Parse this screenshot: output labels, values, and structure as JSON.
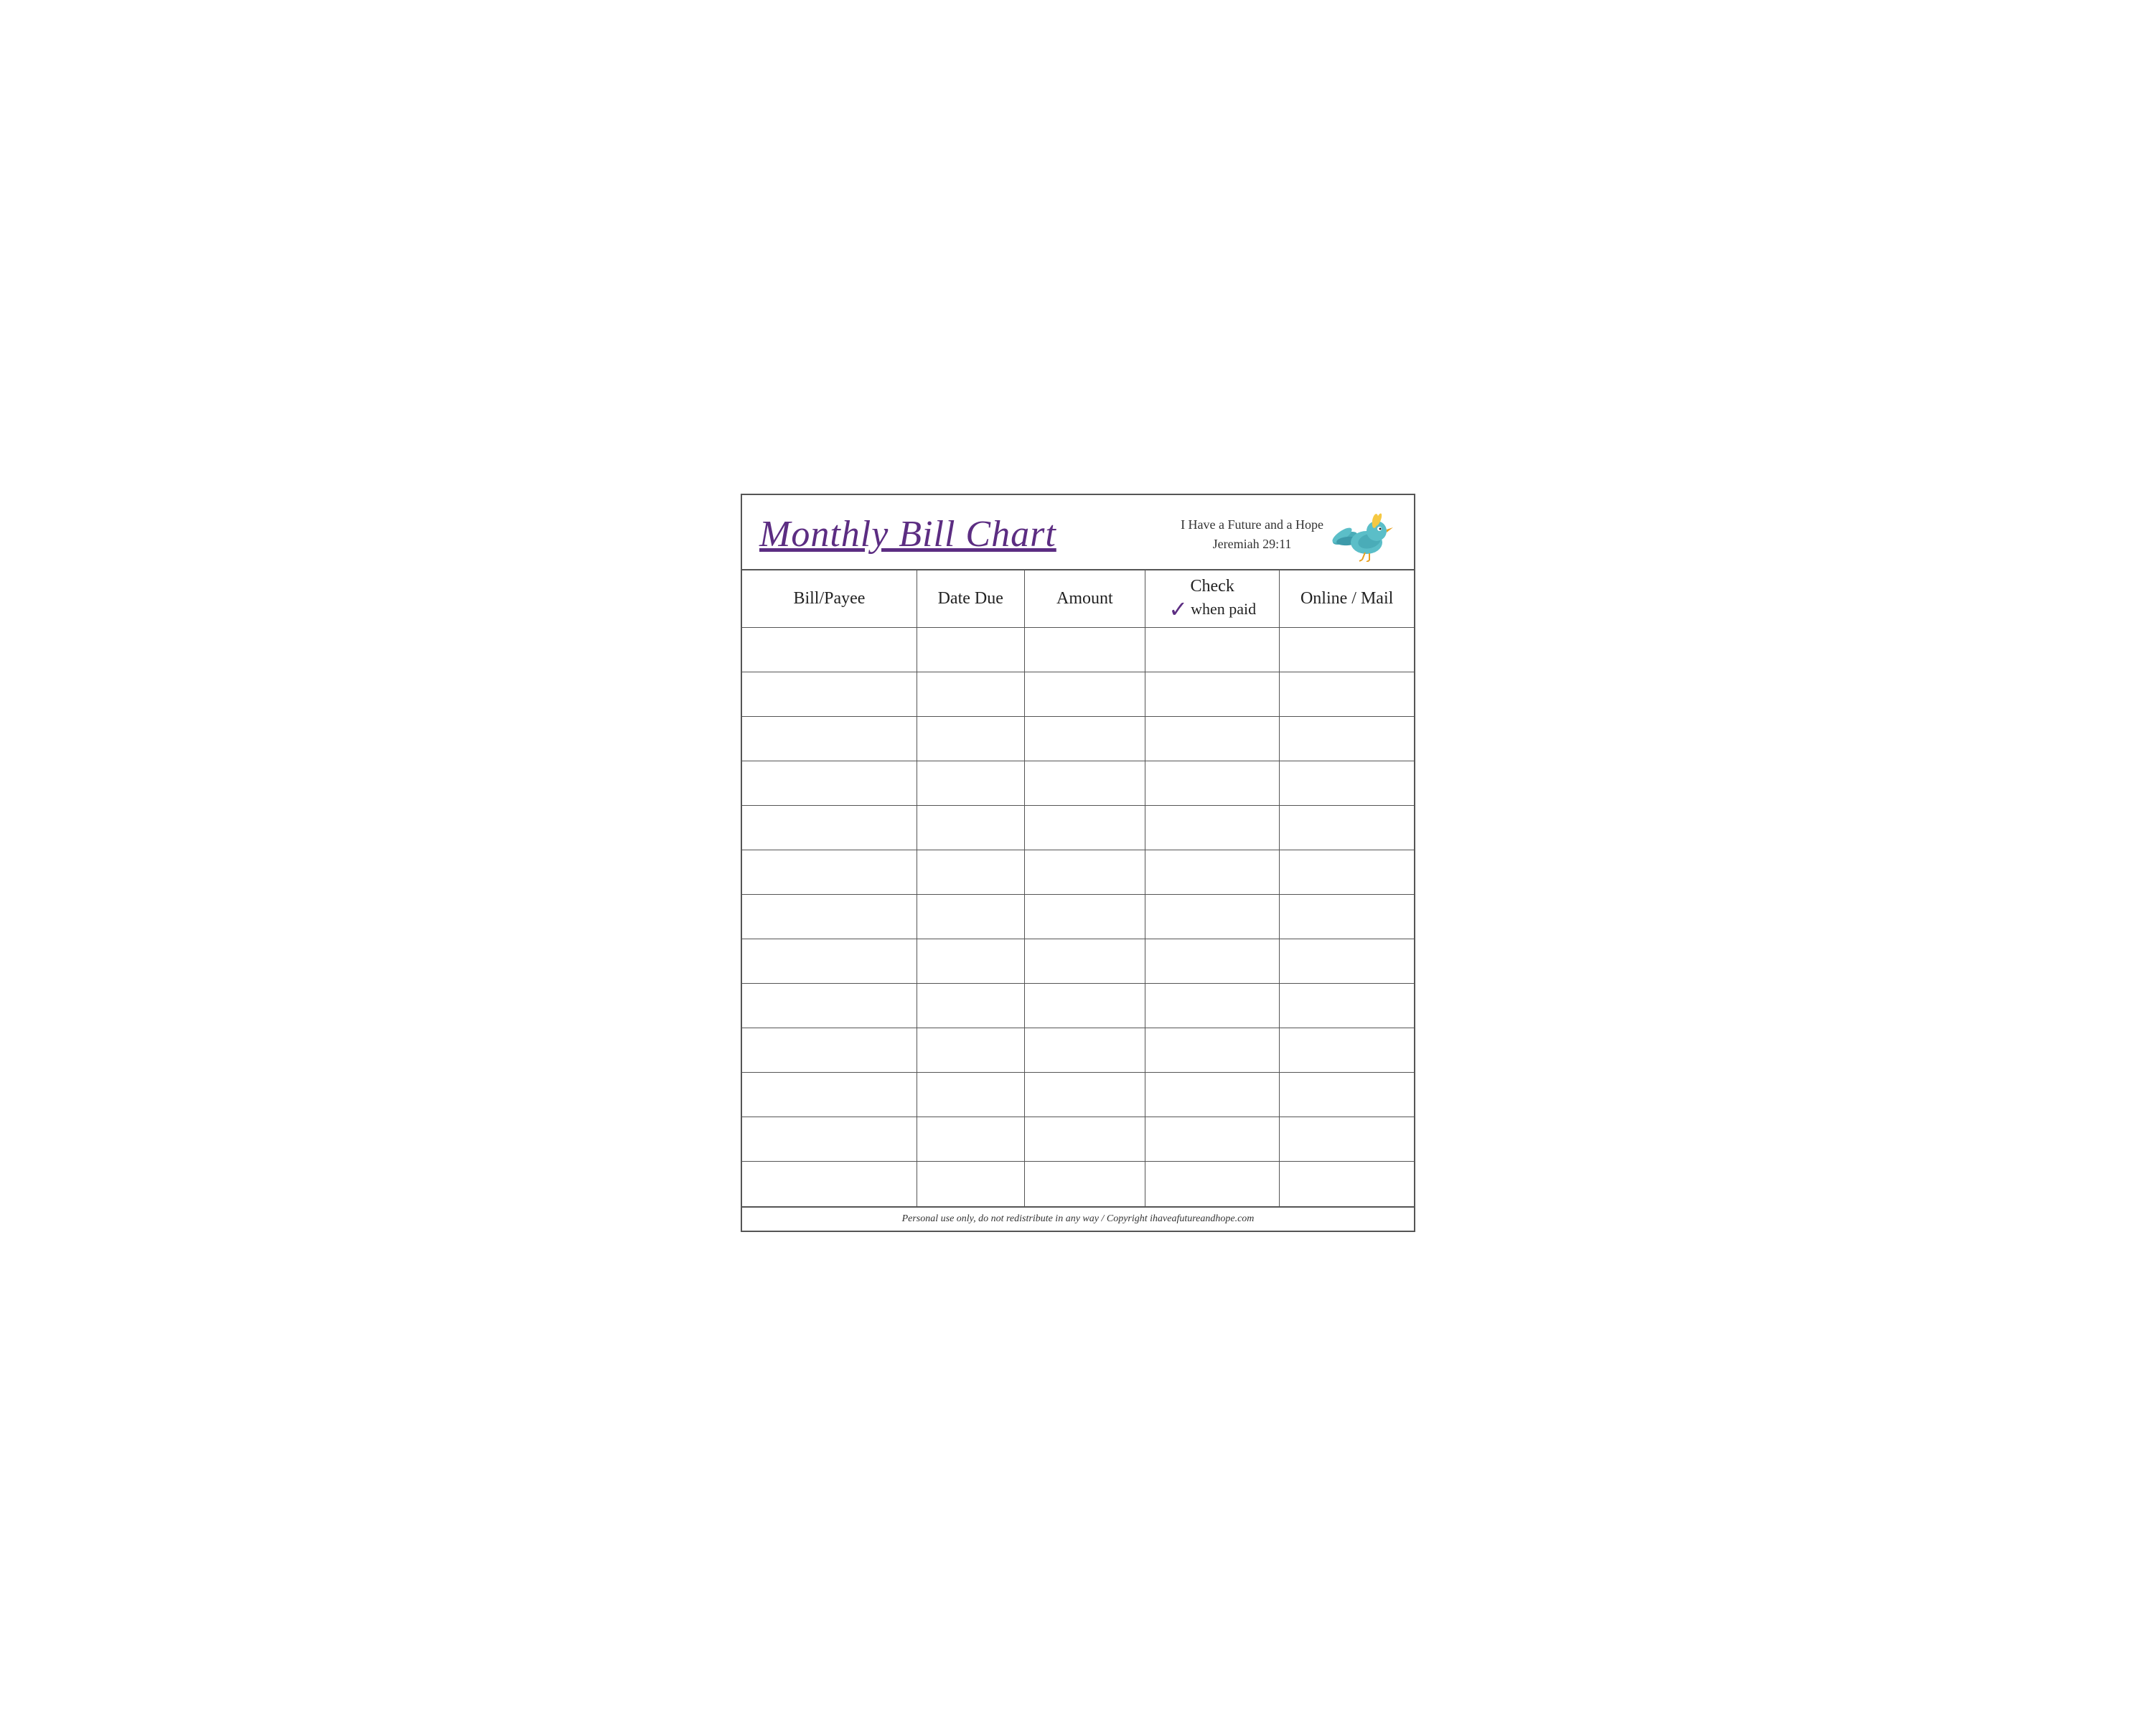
{
  "header": {
    "title": "Monthly Bill Chart",
    "scripture_line1": "I Have a Future and a Hope",
    "scripture_line2": "Jeremiah 29:11"
  },
  "table": {
    "columns": [
      {
        "key": "bill",
        "label": "Bill/Payee"
      },
      {
        "key": "date",
        "label": "Date Due"
      },
      {
        "key": "amount",
        "label": "Amount"
      },
      {
        "key": "check",
        "label_top": "Check",
        "label_bottom": "when paid",
        "has_checkmark": true
      },
      {
        "key": "online",
        "label": "Online / Mail"
      }
    ],
    "row_count": 13
  },
  "footer": {
    "text": "Personal use only, do not redistribute in any way / Copyright ihaveafutureandhope.com"
  }
}
